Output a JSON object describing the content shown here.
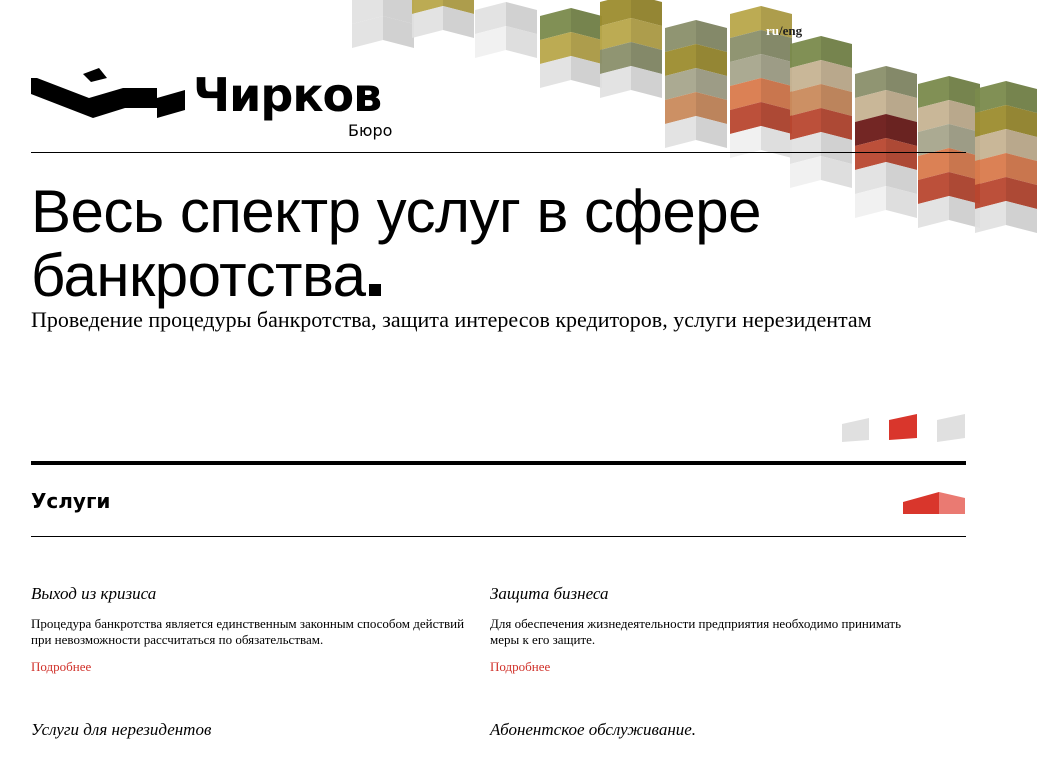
{
  "header": {
    "lang_current": "ru",
    "lang_sep": "/",
    "lang_other": "eng",
    "logo_name": "Чирков",
    "logo_sub": "Бюро"
  },
  "hero": {
    "title": "Весь спектр услуг в сфере банкротства",
    "subtitle": "Проведение процедуры банкротства, защита интересов кредиторов, услуги нерезидентам"
  },
  "services": {
    "heading": "Услуги",
    "items": [
      {
        "title": "Выход из кризиса",
        "text": "Процедура банкротства является единственным законным способом действий при невозможности рассчитаться по обязательствам.",
        "link": "Подробнее"
      },
      {
        "title": "Защита бизнеса",
        "text": "Для обеспечения жизнедеятельности предприятия необходимо принимать меры к его защите.",
        "link": "Подробнее"
      },
      {
        "title": "Услуги для нерезидентов"
      },
      {
        "title": "Абонентское обслуживание."
      }
    ]
  },
  "colors": {
    "accent": "#d0312a",
    "palette": [
      "#7a8a4c",
      "#9c8c2e",
      "#b8a64a",
      "#8a8f6a",
      "#c98a5c",
      "#a7a58c",
      "#d97a4c",
      "#b8472f",
      "#6b1a18",
      "#c6b392",
      "#e0e0e0",
      "#f0f0f0"
    ]
  },
  "slider": {
    "active_index": 1,
    "count": 3
  }
}
